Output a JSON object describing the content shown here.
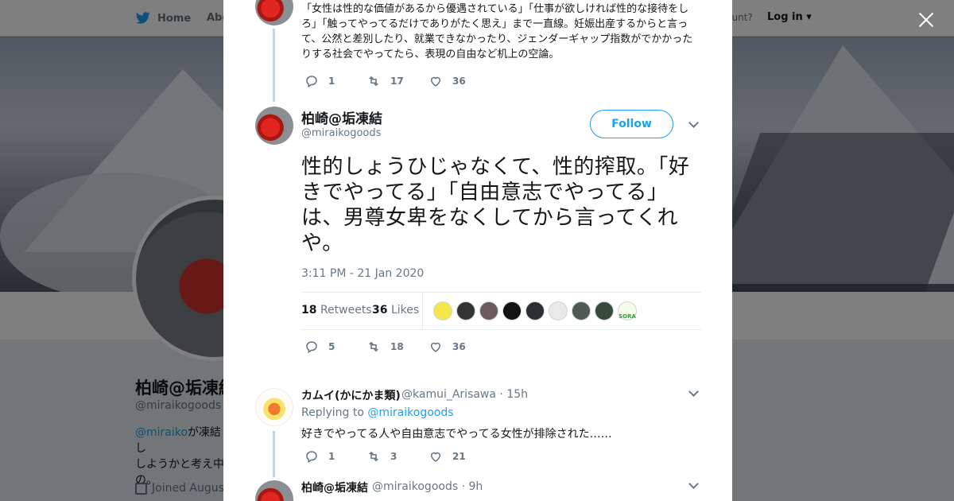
{
  "topbar": {
    "home_label": "Home",
    "about_label": "Abo",
    "account_text": "ccount?",
    "login_label": "Log in"
  },
  "profile": {
    "name": "柏崎@垢凍結",
    "handle": "@miraikogoods",
    "bio_link": "@miraiko",
    "bio_line1": "が凍結し",
    "bio_line2": "しようかと考え中",
    "bio_line3": "の。",
    "joined": "Joined August"
  },
  "prev_tweet": {
    "text": "「女性は性的な価値があるから優遇されている」「仕事が欲しければ性的な接待をしろ」「触ってやってるだけでありがたく思え」まで一直線。妊娠出産するからと言って、公然と差別したり、就業できなかったり、ジェンダーギャップ指数がでかかったりする社会でやってたら、表現の自由など机上の空論。",
    "replies": "1",
    "retweets": "17",
    "likes": "36"
  },
  "main_tweet": {
    "name": "柏崎@垢凍結",
    "handle": "@miraikogoods",
    "follow_label": "Follow",
    "text": "性的しょうひじゃなくて、性的搾取。「好きでやってる」「自由意志でやってる」は、男尊女卑をなくしてから言ってくれや。",
    "timestamp": "3:11 PM - 21 Jan 2020",
    "retweet_count": "18",
    "retweet_label": "Retweets",
    "like_count": "36",
    "like_label": "Likes",
    "replies": "5",
    "retweets": "18",
    "likes": "36",
    "liker_colors": [
      "#f5e74a",
      "#333333",
      "#6b5b5b",
      "#111111",
      "#2b2f33",
      "#e9e9e9",
      "#4e5a52",
      "#3a4a3a",
      "#f4fbe9"
    ],
    "liker_last_text": "SORA"
  },
  "reply1": {
    "name": "カムイ(かにかま類)",
    "handle": "@kamui_Arisawa",
    "time": "· 15h",
    "replying_prefix": "Replying to",
    "replying_to": "@miraikogoods",
    "text": "好きでやってる人や自由意志でやってる女性が排除された……",
    "replies": "1",
    "retweets": "3",
    "likes": "21"
  },
  "reply2": {
    "name": "柏崎@垢凍結",
    "handle": "@miraikogoods",
    "time": "· 9h"
  },
  "colors": {
    "accent": "#1da1f2",
    "text": "#14171a",
    "muted": "#657786"
  }
}
